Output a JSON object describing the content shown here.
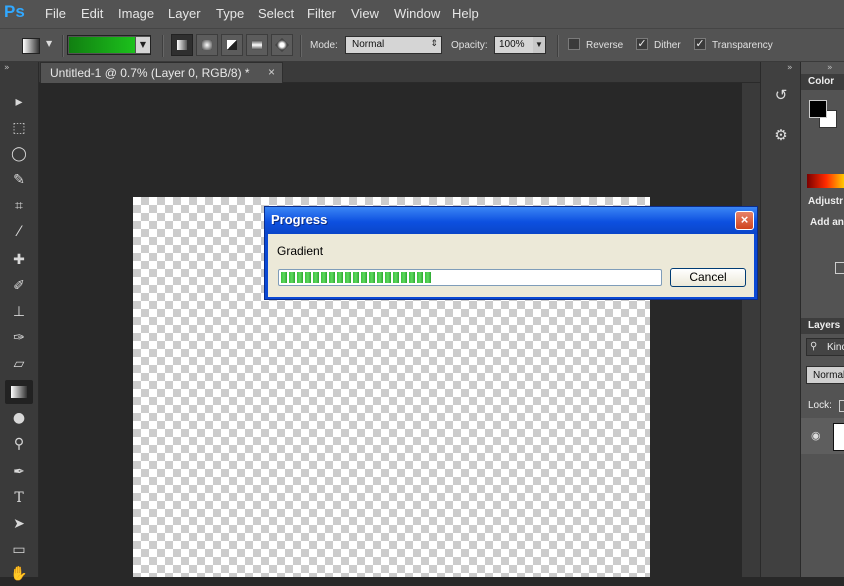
{
  "app": {
    "logo": "Ps"
  },
  "menu": [
    "File",
    "Edit",
    "Image",
    "Layer",
    "Type",
    "Select",
    "Filter",
    "View",
    "Window",
    "Help"
  ],
  "options": {
    "mode_label": "Mode:",
    "mode_value": "Normal",
    "opacity_label": "Opacity:",
    "opacity_value": "100%",
    "reverse_label": "Reverse",
    "dither_label": "Dither",
    "transparency_label": "Transparency",
    "reverse_checked": false,
    "dither_checked": true,
    "transparency_checked": true,
    "gradient_colors": [
      "#117f11",
      "#1cc11c"
    ]
  },
  "document": {
    "tab_label": "Untitled-1 @ 0.7% (Layer 0, RGB/8) *",
    "tab_close": "×"
  },
  "panels": {
    "color_title": "Color",
    "adjustments_title": "Adjustr",
    "adjustments_hint": "Add an",
    "layers_title": "Layers",
    "layers_kind": "Kinc",
    "layers_mode": "Normal",
    "layers_lock": "Lock:",
    "collapse_glyph": "»"
  },
  "dialog": {
    "title": "Progress",
    "close": "×",
    "task": "Gradient",
    "progress": 0.4,
    "cancel_label": "Cancel"
  },
  "colors": {
    "ui_bg": "#535353",
    "canvas_bg": "#282828",
    "xp_title": "#0d50e0",
    "xp_body": "#ece9d8",
    "progress_green": "#38c23c"
  }
}
